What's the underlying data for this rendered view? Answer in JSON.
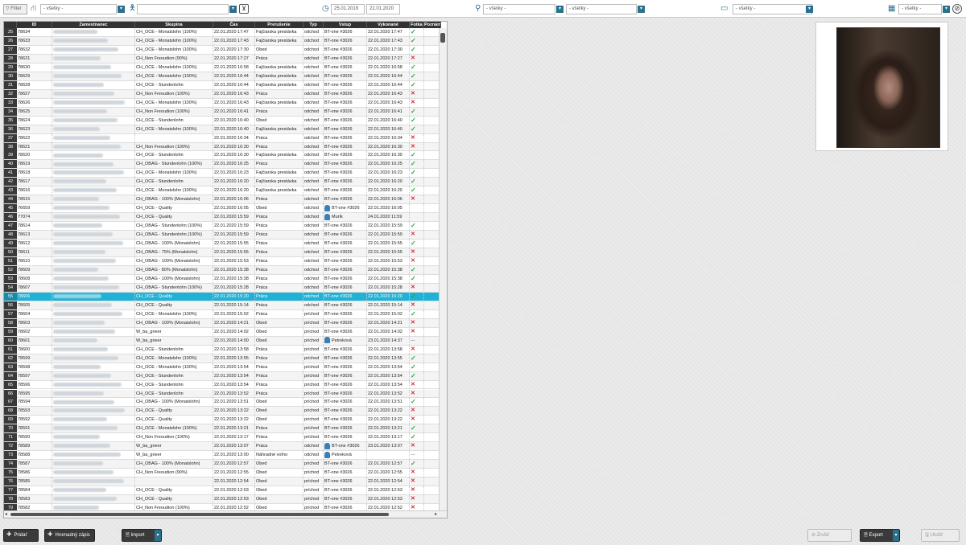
{
  "toolbar": {
    "filter_label": "Filter",
    "filter1_value": "- všetky -",
    "filter2_value": "",
    "date_from": "25.01.2019",
    "date_to": "22.01.2020",
    "filter3_value": "- všetky -",
    "filter4_value": "- všetky -",
    "filter5_value": "- všetky -",
    "filter6_value": "- všetky -"
  },
  "grid": {
    "columns": [
      "ID",
      "Zamestnanec",
      "Skupina",
      "Čas",
      "Prerušenie",
      "Typ",
      "Vstup",
      "Vykonané",
      "Fotka",
      "Poznámka"
    ],
    "rows": [
      {
        "n": "25",
        "id": "78634",
        "grp": "CH_OCE - Monatslohn (100%)",
        "time": "22.01.2020 17:47",
        "int": "Fajčiarska prestávka",
        "type": "odchod",
        "in": "BT-one #3026",
        "done": "22.01.2020 17:47",
        "ph": "ok"
      },
      {
        "n": "26",
        "id": "78633",
        "grp": "CH_OCE - Monatslohn (100%)",
        "time": "22.01.2020 17:43",
        "int": "Fajčiarska prestávka",
        "type": "odchod",
        "in": "BT-one #3026",
        "done": "22.01.2020 17:43",
        "ph": "ok"
      },
      {
        "n": "27",
        "id": "78632",
        "grp": "CH_OCE - Monatslohn (100%)",
        "time": "22.01.2020 17:30",
        "int": "Obed",
        "type": "odchod",
        "in": "BT-one #3026",
        "done": "22.01.2020 17:30",
        "ph": "ok"
      },
      {
        "n": "28",
        "id": "78631",
        "grp": "CH_Non Freoudion (90%)",
        "time": "22.01.2020 17:27",
        "int": "Práca",
        "type": "odchod",
        "in": "BT-one #3026",
        "done": "22.01.2020 17:27",
        "ph": "bad"
      },
      {
        "n": "29",
        "id": "78630",
        "grp": "CH_OCE - Monatslohn (100%)",
        "time": "22.01.2020 16:58",
        "int": "Fajčiarska prestávka",
        "type": "odchod",
        "in": "BT-one #3026",
        "done": "22.01.2020 16:58",
        "ph": "ok"
      },
      {
        "n": "30",
        "id": "78629",
        "grp": "CH_OCE - Monatslohn (100%)",
        "time": "22.01.2020 16:44",
        "int": "Fajčiarska prestávka",
        "type": "odchod",
        "in": "BT-one #3026",
        "done": "22.01.2020 16:44",
        "ph": "ok"
      },
      {
        "n": "31",
        "id": "78628",
        "grp": "CH_OCE - Stundenlohn",
        "time": "22.01.2020 16:44",
        "int": "Fajčiarska prestávka",
        "type": "odchod",
        "in": "BT-one #3026",
        "done": "22.01.2020 16:44",
        "ph": "ok"
      },
      {
        "n": "32",
        "id": "78627",
        "grp": "CH_Non Freoudion (100%)",
        "time": "22.01.2020 16:43",
        "int": "Práca",
        "type": "odchod",
        "in": "BT-one #3026",
        "done": "22.01.2020 16:43",
        "ph": "bad"
      },
      {
        "n": "33",
        "id": "78626",
        "grp": "CH_OCE - Monatslohn (100%)",
        "time": "22.01.2020 16:43",
        "int": "Fajčiarska prestávka",
        "type": "odchod",
        "in": "BT-one #3026",
        "done": "22.01.2020 16:43",
        "ph": "bad"
      },
      {
        "n": "34",
        "id": "78625",
        "grp": "CH_Non Freoudion (100%)",
        "time": "22.01.2020 16:41",
        "int": "Práca",
        "type": "odchod",
        "in": "BT-one #3026",
        "done": "22.01.2020 16:41",
        "ph": "ok"
      },
      {
        "n": "35",
        "id": "78624",
        "grp": "CH_OCE - Stundenlohn",
        "time": "22.01.2020 16:40",
        "int": "Obed",
        "type": "odchod",
        "in": "BT-one #3026",
        "done": "22.01.2020 16:40",
        "ph": "ok"
      },
      {
        "n": "36",
        "id": "78623",
        "grp": "CH_OCE - Monatslohn (100%)",
        "time": "22.01.2020 16:40",
        "int": "Fajčiarska prestávka",
        "type": "odchod",
        "in": "BT-one #3026",
        "done": "22.01.2020 16:40",
        "ph": "ok"
      },
      {
        "n": "37",
        "id": "78622",
        "grp": "",
        "time": "22.01.2020 16:34",
        "int": "Práca",
        "type": "odchod",
        "in": "BT-one #3026",
        "done": "22.01.2020 16:34",
        "ph": "bad"
      },
      {
        "n": "38",
        "id": "78621",
        "grp": "CH_Non Freoudion (100%)",
        "time": "22.01.2020 16:30",
        "int": "Práca",
        "type": "odchod",
        "in": "BT-one #3026",
        "done": "22.01.2020 16:30",
        "ph": "bad"
      },
      {
        "n": "39",
        "id": "78620",
        "grp": "CH_OCE - Stundenlohn",
        "time": "22.01.2020 16:30",
        "int": "Fajčiarska prestávka",
        "type": "odchod",
        "in": "BT-one #3026",
        "done": "22.01.2020 16:30",
        "ph": "ok"
      },
      {
        "n": "40",
        "id": "78619",
        "grp": "CH_OBAG - Stundenlohn (100%)",
        "time": "22.01.2020 16:25",
        "int": "Práca",
        "type": "odchod",
        "in": "BT-one #3026",
        "done": "22.01.2020 16:25",
        "ph": "ok"
      },
      {
        "n": "41",
        "id": "78618",
        "grp": "CH_OCE - Monatslohn (100%)",
        "time": "22.01.2020 16:23",
        "int": "Fajčiarska prestávka",
        "type": "odchod",
        "in": "BT-one #3026",
        "done": "22.01.2020 16:23",
        "ph": "ok"
      },
      {
        "n": "42",
        "id": "78617",
        "grp": "CH_OCE - Stundenlohn",
        "time": "22.01.2020 16:20",
        "int": "Fajčiarska prestávka",
        "type": "odchod",
        "in": "BT-one #3026",
        "done": "22.01.2020 16:20",
        "ph": "ok"
      },
      {
        "n": "43",
        "id": "78616",
        "grp": "CH_OCE - Monatslohn (100%)",
        "time": "22.01.2020 16:20",
        "int": "Fajčiarska prestávka",
        "type": "odchod",
        "in": "BT-one #3026",
        "done": "22.01.2020 16:20",
        "ph": "ok"
      },
      {
        "n": "44",
        "id": "78615",
        "grp": "CH_OBAG - 100% (Monatslohn)",
        "time": "22.01.2020 16:06",
        "int": "Práca",
        "type": "odchod",
        "in": "BT-one #3026",
        "done": "22.01.2020 16:06",
        "ph": "bad"
      },
      {
        "n": "45",
        "id": "76659",
        "grp": "CH_OCE - Quality",
        "time": "22.01.2020 16:05",
        "int": "Obed",
        "type": "odchod",
        "in": "BT-one #3026",
        "done": "22.01.2020 16:05",
        "ph": "",
        "person": true
      },
      {
        "n": "46",
        "id": "77074",
        "grp": "CH_OCE - Quality",
        "time": "22.01.2020 15:59",
        "int": "Práca",
        "type": "odchod",
        "in": "Murík",
        "done": "24.01.2020 11:59",
        "ph": "",
        "person": true
      },
      {
        "n": "47",
        "id": "78614",
        "grp": "CH_OBAG - Stundenlohn (100%)",
        "time": "22.01.2020 15:59",
        "int": "Práca",
        "type": "odchod",
        "in": "BT-one #3026",
        "done": "22.01.2020 15:59",
        "ph": "ok"
      },
      {
        "n": "48",
        "id": "78613",
        "grp": "CH_OBAG - Stundenlohn (100%)",
        "time": "22.01.2020 15:59",
        "int": "Práca",
        "type": "odchod",
        "in": "BT-one #3026",
        "done": "22.01.2020 15:59",
        "ph": "bad"
      },
      {
        "n": "49",
        "id": "78612",
        "grp": "CH_OBAG - 100% (Monatslohn)",
        "time": "22.01.2020 15:55",
        "int": "Práca",
        "type": "odchod",
        "in": "BT-one #3026",
        "done": "22.01.2020 15:55",
        "ph": "ok"
      },
      {
        "n": "50",
        "id": "78611",
        "grp": "CH_OBAG - 75% (Monatslohn)",
        "time": "22.01.2020 15:55",
        "int": "Práca",
        "type": "odchod",
        "in": "BT-one #3026",
        "done": "22.01.2020 15:55",
        "ph": "bad"
      },
      {
        "n": "51",
        "id": "78610",
        "grp": "CH_OBAG - 100% (Monatslohn)",
        "time": "22.01.2020 15:53",
        "int": "Práca",
        "type": "odchod",
        "in": "BT-one #3026",
        "done": "22.01.2020 15:53",
        "ph": "bad"
      },
      {
        "n": "52",
        "id": "78609",
        "grp": "CH_OBAG - 80% (Monatslohn)",
        "time": "22.01.2020 15:38",
        "int": "Práca",
        "type": "odchod",
        "in": "BT-one #3026",
        "done": "22.01.2020 15:38",
        "ph": "ok"
      },
      {
        "n": "53",
        "id": "78608",
        "grp": "CH_OBAG - 100% (Monatslohn)",
        "time": "22.01.2020 15:38",
        "int": "Práca",
        "type": "odchod",
        "in": "BT-one #3026",
        "done": "22.01.2020 15:38",
        "ph": "ok"
      },
      {
        "n": "54",
        "id": "78607",
        "grp": "CH_OBAG - Stundenlohn (100%)",
        "time": "22.01.2020 15:28",
        "int": "Práca",
        "type": "odchod",
        "in": "BT-one #3026",
        "done": "22.01.2020 15:28",
        "ph": "bad"
      },
      {
        "n": "55",
        "id": "78606",
        "grp": "CH_OCE - Quality",
        "time": "22.01.2020 15:20",
        "int": "Práca",
        "type": "odchod",
        "in": "BT-one #3026",
        "done": "22.01.2020 15:20",
        "ph": "ok",
        "selected": true
      },
      {
        "n": "56",
        "id": "78605",
        "grp": "CH_OCE - Quality",
        "time": "22.01.2020 15:14",
        "int": "Práca",
        "type": "odchod",
        "in": "BT-one #3026",
        "done": "22.01.2020 15:14",
        "ph": "bad"
      },
      {
        "n": "57",
        "id": "78604",
        "grp": "CH_OCE - Monatslohn (100%)",
        "time": "22.01.2020 15:02",
        "int": "Práca",
        "type": "príchod",
        "in": "BT-one #3026",
        "done": "22.01.2020 15:02",
        "ph": "ok"
      },
      {
        "n": "58",
        "id": "78603",
        "grp": "CH_OBAG - 100% (Monatslohn)",
        "time": "22.01.2020 14:21",
        "int": "Obed",
        "type": "príchod",
        "in": "BT-one #3026",
        "done": "22.01.2020 14:21",
        "ph": "bad"
      },
      {
        "n": "59",
        "id": "78602",
        "grp": "W_ba_gneer",
        "time": "22.01.2020 14:02",
        "int": "Obed",
        "type": "príchod",
        "in": "BT-one #3026",
        "done": "22.01.2020 14:02",
        "ph": "bad"
      },
      {
        "n": "60",
        "id": "78601",
        "grp": "W_ba_gneer",
        "time": "22.01.2020 14:00",
        "int": "Obed",
        "type": "príchod",
        "in": "Petreková",
        "done": "23.01.2020 14:37",
        "ph": "dash",
        "person": true
      },
      {
        "n": "61",
        "id": "78600",
        "grp": "CH_OCE - Stundenlohn",
        "time": "22.01.2020 13:58",
        "int": "Práca",
        "type": "príchod",
        "in": "BT-one #3026",
        "done": "22.01.2020 13:58",
        "ph": "bad"
      },
      {
        "n": "62",
        "id": "78599",
        "grp": "CH_OCE - Monatslohn (100%)",
        "time": "22.01.2020 13:55",
        "int": "Práca",
        "type": "príchod",
        "in": "BT-one #3026",
        "done": "22.01.2020 13:55",
        "ph": "ok"
      },
      {
        "n": "63",
        "id": "78598",
        "grp": "CH_OCE - Monatslohn (100%)",
        "time": "22.01.2020 13:54",
        "int": "Práca",
        "type": "príchod",
        "in": "BT-one #3026",
        "done": "22.01.2020 13:54",
        "ph": "ok"
      },
      {
        "n": "64",
        "id": "78597",
        "grp": "CH_OCE - Stundenlohn",
        "time": "22.01.2020 13:54",
        "int": "Práca",
        "type": "príchod",
        "in": "BT-one #3026",
        "done": "22.01.2020 13:54",
        "ph": "ok"
      },
      {
        "n": "65",
        "id": "78596",
        "grp": "CH_OCE - Stundenlohn",
        "time": "22.01.2020 13:54",
        "int": "Práca",
        "type": "príchod",
        "in": "BT-one #3026",
        "done": "22.01.2020 13:54",
        "ph": "bad"
      },
      {
        "n": "66",
        "id": "78595",
        "grp": "CH_OCE - Stundenlohn",
        "time": "22.01.2020 13:52",
        "int": "Práca",
        "type": "príchod",
        "in": "BT-one #3026",
        "done": "22.01.2020 13:52",
        "ph": "bad"
      },
      {
        "n": "67",
        "id": "78594",
        "grp": "CH_OBAG - 100% (Monatslohn)",
        "time": "22.01.2020 13:51",
        "int": "Obed",
        "type": "príchod",
        "in": "BT-one #3026",
        "done": "22.01.2020 13:51",
        "ph": "ok"
      },
      {
        "n": "68",
        "id": "78593",
        "grp": "CH_OCE - Quality",
        "time": "22.01.2020 13:22",
        "int": "Obed",
        "type": "príchod",
        "in": "BT-one #3026",
        "done": "22.01.2020 13:22",
        "ph": "bad"
      },
      {
        "n": "69",
        "id": "78592",
        "grp": "CH_OCE - Quality",
        "time": "22.01.2020 13:22",
        "int": "Obed",
        "type": "príchod",
        "in": "BT-one #3026",
        "done": "22.01.2020 13:22",
        "ph": "bad"
      },
      {
        "n": "70",
        "id": "78591",
        "grp": "CH_OCE - Monatslohn (100%)",
        "time": "22.01.2020 13:21",
        "int": "Práca",
        "type": "príchod",
        "in": "BT-one #3026",
        "done": "22.01.2020 13:21",
        "ph": "ok"
      },
      {
        "n": "71",
        "id": "78590",
        "grp": "CH_Non Freoudion (100%)",
        "time": "22.01.2020 13:17",
        "int": "Práca",
        "type": "príchod",
        "in": "BT-one #3026",
        "done": "22.01.2020 13:17",
        "ph": "ok"
      },
      {
        "n": "72",
        "id": "78589",
        "grp": "W_ba_gneer",
        "time": "22.01.2020 13:07",
        "int": "Práca",
        "type": "odchod",
        "in": "BT-one #3026",
        "done": "23.01.2020 13:07",
        "ph": "bad",
        "person": true
      },
      {
        "n": "73",
        "id": "78588",
        "grp": "W_ba_gneer",
        "time": "22.01.2020 13:00",
        "int": "Náhradné voľno",
        "type": "odchod",
        "in": "Petreková",
        "done": "",
        "ph": "dash",
        "person": true
      },
      {
        "n": "74",
        "id": "78587",
        "grp": "CH_OBAG - 100% (Monatslohn)",
        "time": "22.01.2020 12:57",
        "int": "Obed",
        "type": "príchod",
        "in": "BT-one #3026",
        "done": "22.01.2020 12:57",
        "ph": "ok"
      },
      {
        "n": "75",
        "id": "78586",
        "grp": "CH_Non Freoudion (90%)",
        "time": "22.01.2020 12:55",
        "int": "Obed",
        "type": "príchod",
        "in": "BT-one #3026",
        "done": "22.01.2020 12:55",
        "ph": "bad"
      },
      {
        "n": "76",
        "id": "78585",
        "grp": "",
        "time": "22.01.2020 12:54",
        "int": "Obed",
        "type": "príchod",
        "in": "BT-one #3026",
        "done": "22.01.2020 12:54",
        "ph": "bad"
      },
      {
        "n": "77",
        "id": "78584",
        "grp": "CH_OCE - Quality",
        "time": "22.01.2020 12:53",
        "int": "Obed",
        "type": "príchod",
        "in": "BT-one #3026",
        "done": "22.01.2020 12:53",
        "ph": "bad"
      },
      {
        "n": "78",
        "id": "78583",
        "grp": "CH_OCE - Quality",
        "time": "22.01.2020 12:53",
        "int": "Obed",
        "type": "príchod",
        "in": "BT-one #3026",
        "done": "22.01.2020 12:53",
        "ph": "bad"
      },
      {
        "n": "79",
        "id": "78582",
        "grp": "CH_Non Freoudion (100%)",
        "time": "22.01.2020 12:52",
        "int": "Obed",
        "type": "príchod",
        "in": "BT-one #3026",
        "done": "22.01.2020 12:52",
        "ph": "bad"
      }
    ]
  },
  "bottom": {
    "add_label": "Pridať",
    "bulk_add_label": "Hromadný zápis",
    "import_label": "Import",
    "cancel_label": "Zrušiť",
    "export_label": "Export",
    "save_label": "Uložiť"
  },
  "colors": {
    "accent": "#2b6f8c",
    "selected_row": "#1fb1d6",
    "ok": "#28a745",
    "bad": "#d9272e"
  }
}
